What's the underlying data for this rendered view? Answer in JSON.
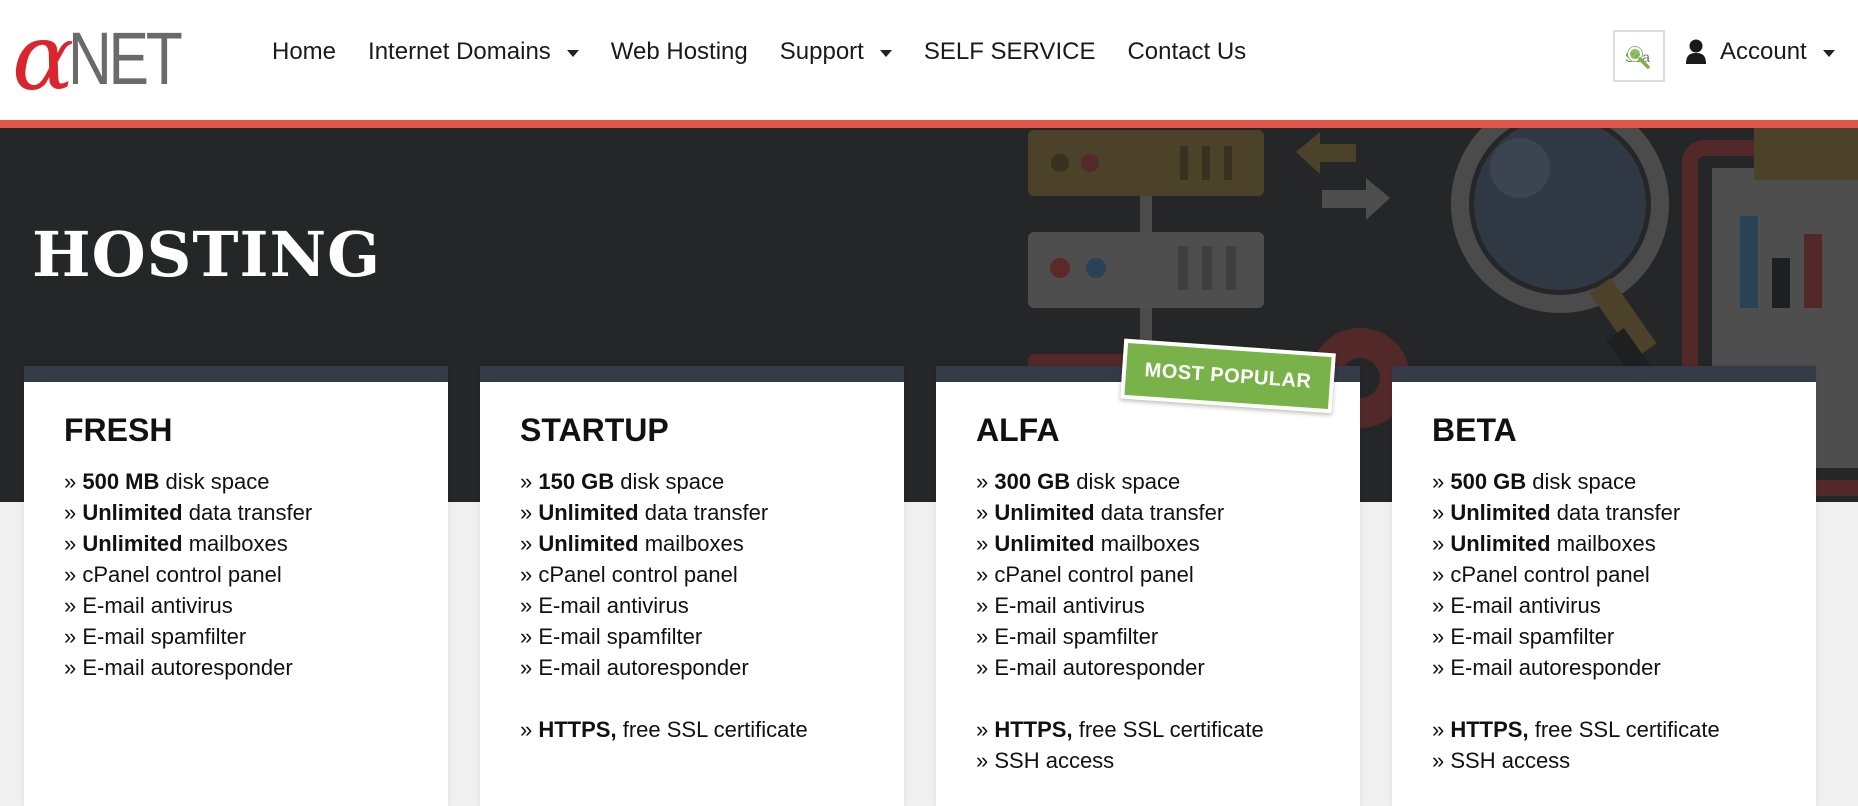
{
  "header": {
    "logo": {
      "alpha": "α",
      "text": "NET"
    },
    "nav": [
      {
        "label": "Home",
        "dropdown": false
      },
      {
        "label": "Internet Domains",
        "dropdown": true
      },
      {
        "label": "Web Hosting",
        "dropdown": false
      },
      {
        "label": "Support",
        "dropdown": true
      },
      {
        "label": "SELF SERVICE",
        "dropdown": false
      },
      {
        "label": "Contact Us",
        "dropdown": false
      }
    ],
    "search": {
      "placeholder": "Sea",
      "icon": "search-icon"
    },
    "account": {
      "label": "Account",
      "icon": "user-icon"
    }
  },
  "hero": {
    "title": "HOSTING"
  },
  "badge": {
    "label": "MOST POPULAR"
  },
  "plans": [
    {
      "name": "FRESH",
      "features": [
        {
          "prefix": "» ",
          "bold": "500 MB",
          "text": " disk space"
        },
        {
          "prefix": "» ",
          "bold": "Unlimited",
          "text": " data transfer"
        },
        {
          "prefix": "» ",
          "bold": "Unlimited",
          "text": " mailboxes"
        },
        {
          "prefix": "» ",
          "bold": "",
          "text": "cPanel control panel"
        },
        {
          "prefix": "» ",
          "bold": "",
          "text": "E-mail antivirus"
        },
        {
          "prefix": "» ",
          "bold": "",
          "text": "E-mail spamfilter"
        },
        {
          "prefix": "» ",
          "bold": "",
          "text": "E-mail autoresponder"
        }
      ],
      "extras": []
    },
    {
      "name": "STARTUP",
      "features": [
        {
          "prefix": "» ",
          "bold": "150 GB",
          "text": " disk space"
        },
        {
          "prefix": "» ",
          "bold": "Unlimited",
          "text": " data transfer"
        },
        {
          "prefix": "» ",
          "bold": "Unlimited",
          "text": " mailboxes"
        },
        {
          "prefix": "» ",
          "bold": "",
          "text": "cPanel control panel"
        },
        {
          "prefix": "» ",
          "bold": "",
          "text": "E-mail antivirus"
        },
        {
          "prefix": "» ",
          "bold": "",
          "text": "E-mail spamfilter"
        },
        {
          "prefix": "» ",
          "bold": "",
          "text": "E-mail autoresponder"
        }
      ],
      "extras": [
        {
          "prefix": "» ",
          "bold": "HTTPS,",
          "text": " free SSL certificate"
        }
      ]
    },
    {
      "name": "ALFA",
      "features": [
        {
          "prefix": "» ",
          "bold": "300 GB",
          "text": " disk space"
        },
        {
          "prefix": "» ",
          "bold": "Unlimited",
          "text": " data transfer"
        },
        {
          "prefix": "» ",
          "bold": "Unlimited",
          "text": " mailboxes"
        },
        {
          "prefix": "» ",
          "bold": "",
          "text": "cPanel control panel"
        },
        {
          "prefix": "» ",
          "bold": "",
          "text": "E-mail antivirus"
        },
        {
          "prefix": "» ",
          "bold": "",
          "text": "E-mail spamfilter"
        },
        {
          "prefix": "» ",
          "bold": "",
          "text": "E-mail autoresponder"
        }
      ],
      "extras": [
        {
          "prefix": "» ",
          "bold": "HTTPS,",
          "text": " free SSL certificate"
        },
        {
          "prefix": "» ",
          "bold": "",
          "text": "SSH access"
        }
      ]
    },
    {
      "name": "BETA",
      "features": [
        {
          "prefix": "» ",
          "bold": "500 GB",
          "text": " disk space"
        },
        {
          "prefix": "» ",
          "bold": "Unlimited",
          "text": " data transfer"
        },
        {
          "prefix": "» ",
          "bold": "Unlimited",
          "text": " mailboxes"
        },
        {
          "prefix": "» ",
          "bold": "",
          "text": "cPanel control panel"
        },
        {
          "prefix": "» ",
          "bold": "",
          "text": "E-mail antivirus"
        },
        {
          "prefix": "» ",
          "bold": "",
          "text": "E-mail spamfilter"
        },
        {
          "prefix": "» ",
          "bold": "",
          "text": "E-mail autoresponder"
        }
      ],
      "extras": [
        {
          "prefix": "» ",
          "bold": "HTTPS,",
          "text": " free SSL certificate"
        },
        {
          "prefix": "» ",
          "bold": "",
          "text": "SSH access"
        }
      ]
    }
  ],
  "colors": {
    "accent": "#e2564b",
    "hero_bg": "#252628",
    "card_top": "#353a47",
    "badge": "#7ab24a"
  }
}
